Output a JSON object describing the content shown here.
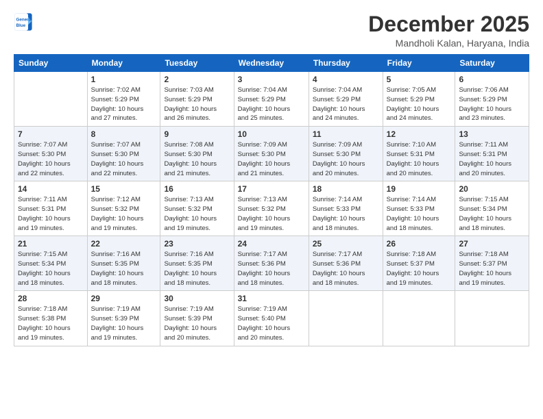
{
  "logo": {
    "line1": "General",
    "line2": "Blue"
  },
  "title": "December 2025",
  "subtitle": "Mandholi Kalan, Haryana, India",
  "days_header": [
    "Sunday",
    "Monday",
    "Tuesday",
    "Wednesday",
    "Thursday",
    "Friday",
    "Saturday"
  ],
  "weeks": [
    [
      {
        "num": "",
        "info": ""
      },
      {
        "num": "1",
        "info": "Sunrise: 7:02 AM\nSunset: 5:29 PM\nDaylight: 10 hours\nand 27 minutes."
      },
      {
        "num": "2",
        "info": "Sunrise: 7:03 AM\nSunset: 5:29 PM\nDaylight: 10 hours\nand 26 minutes."
      },
      {
        "num": "3",
        "info": "Sunrise: 7:04 AM\nSunset: 5:29 PM\nDaylight: 10 hours\nand 25 minutes."
      },
      {
        "num": "4",
        "info": "Sunrise: 7:04 AM\nSunset: 5:29 PM\nDaylight: 10 hours\nand 24 minutes."
      },
      {
        "num": "5",
        "info": "Sunrise: 7:05 AM\nSunset: 5:29 PM\nDaylight: 10 hours\nand 24 minutes."
      },
      {
        "num": "6",
        "info": "Sunrise: 7:06 AM\nSunset: 5:29 PM\nDaylight: 10 hours\nand 23 minutes."
      }
    ],
    [
      {
        "num": "7",
        "info": "Sunrise: 7:07 AM\nSunset: 5:30 PM\nDaylight: 10 hours\nand 22 minutes."
      },
      {
        "num": "8",
        "info": "Sunrise: 7:07 AM\nSunset: 5:30 PM\nDaylight: 10 hours\nand 22 minutes."
      },
      {
        "num": "9",
        "info": "Sunrise: 7:08 AM\nSunset: 5:30 PM\nDaylight: 10 hours\nand 21 minutes."
      },
      {
        "num": "10",
        "info": "Sunrise: 7:09 AM\nSunset: 5:30 PM\nDaylight: 10 hours\nand 21 minutes."
      },
      {
        "num": "11",
        "info": "Sunrise: 7:09 AM\nSunset: 5:30 PM\nDaylight: 10 hours\nand 20 minutes."
      },
      {
        "num": "12",
        "info": "Sunrise: 7:10 AM\nSunset: 5:31 PM\nDaylight: 10 hours\nand 20 minutes."
      },
      {
        "num": "13",
        "info": "Sunrise: 7:11 AM\nSunset: 5:31 PM\nDaylight: 10 hours\nand 20 minutes."
      }
    ],
    [
      {
        "num": "14",
        "info": "Sunrise: 7:11 AM\nSunset: 5:31 PM\nDaylight: 10 hours\nand 19 minutes."
      },
      {
        "num": "15",
        "info": "Sunrise: 7:12 AM\nSunset: 5:32 PM\nDaylight: 10 hours\nand 19 minutes."
      },
      {
        "num": "16",
        "info": "Sunrise: 7:13 AM\nSunset: 5:32 PM\nDaylight: 10 hours\nand 19 minutes."
      },
      {
        "num": "17",
        "info": "Sunrise: 7:13 AM\nSunset: 5:32 PM\nDaylight: 10 hours\nand 19 minutes."
      },
      {
        "num": "18",
        "info": "Sunrise: 7:14 AM\nSunset: 5:33 PM\nDaylight: 10 hours\nand 18 minutes."
      },
      {
        "num": "19",
        "info": "Sunrise: 7:14 AM\nSunset: 5:33 PM\nDaylight: 10 hours\nand 18 minutes."
      },
      {
        "num": "20",
        "info": "Sunrise: 7:15 AM\nSunset: 5:34 PM\nDaylight: 10 hours\nand 18 minutes."
      }
    ],
    [
      {
        "num": "21",
        "info": "Sunrise: 7:15 AM\nSunset: 5:34 PM\nDaylight: 10 hours\nand 18 minutes."
      },
      {
        "num": "22",
        "info": "Sunrise: 7:16 AM\nSunset: 5:35 PM\nDaylight: 10 hours\nand 18 minutes."
      },
      {
        "num": "23",
        "info": "Sunrise: 7:16 AM\nSunset: 5:35 PM\nDaylight: 10 hours\nand 18 minutes."
      },
      {
        "num": "24",
        "info": "Sunrise: 7:17 AM\nSunset: 5:36 PM\nDaylight: 10 hours\nand 18 minutes."
      },
      {
        "num": "25",
        "info": "Sunrise: 7:17 AM\nSunset: 5:36 PM\nDaylight: 10 hours\nand 18 minutes."
      },
      {
        "num": "26",
        "info": "Sunrise: 7:18 AM\nSunset: 5:37 PM\nDaylight: 10 hours\nand 19 minutes."
      },
      {
        "num": "27",
        "info": "Sunrise: 7:18 AM\nSunset: 5:37 PM\nDaylight: 10 hours\nand 19 minutes."
      }
    ],
    [
      {
        "num": "28",
        "info": "Sunrise: 7:18 AM\nSunset: 5:38 PM\nDaylight: 10 hours\nand 19 minutes."
      },
      {
        "num": "29",
        "info": "Sunrise: 7:19 AM\nSunset: 5:39 PM\nDaylight: 10 hours\nand 19 minutes."
      },
      {
        "num": "30",
        "info": "Sunrise: 7:19 AM\nSunset: 5:39 PM\nDaylight: 10 hours\nand 20 minutes."
      },
      {
        "num": "31",
        "info": "Sunrise: 7:19 AM\nSunset: 5:40 PM\nDaylight: 10 hours\nand 20 minutes."
      },
      {
        "num": "",
        "info": ""
      },
      {
        "num": "",
        "info": ""
      },
      {
        "num": "",
        "info": ""
      }
    ]
  ]
}
